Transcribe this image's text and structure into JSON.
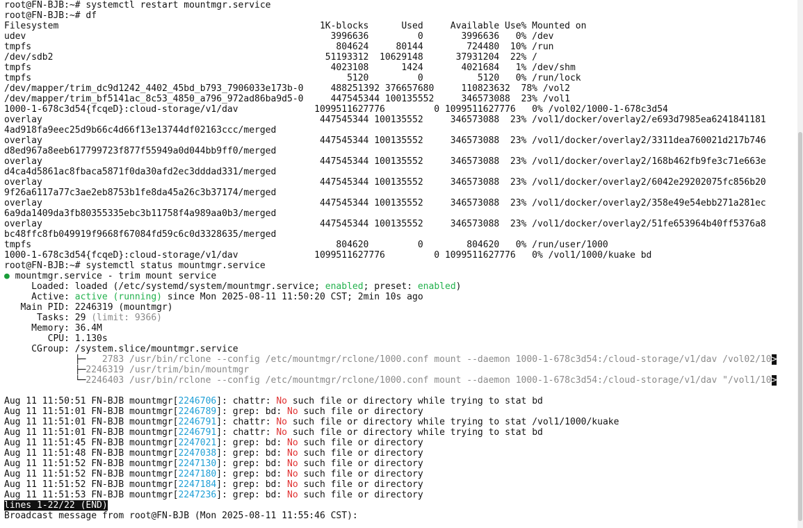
{
  "terminal": {
    "l1": "root@FN-BJB:~# systemctl restart mountmgr.service",
    "l2": "root@FN-BJB:~# df",
    "l3": "Filesystem                                                1K-blocks      Used     Available Use% Mounted on",
    "l4": "udev                                                        3996636         0       3996636   0% /dev",
    "l5": "tmpfs                                                        804624     80144        724480  10% /run",
    "l6": "/dev/sdb2                                                  51193312  10629148      37931204  22% /",
    "l7": "tmpfs                                                       4023108      1424       4021684   1% /dev/shm",
    "l8": "tmpfs                                                          5120         0          5120   0% /run/lock",
    "l9": "/dev/mapper/trim_dc9d1242_4402_45bd_b793_7906033e173b-0     488251392 376657680     110823632  78% /vol2",
    "l10": "/dev/mapper/trim_bf5141ac_8c53_4850_a796_972ad86ba9d5-0     447545344 100135552     346573088  23% /vol1",
    "l11": "1000-1-678c3d54{fcqeD}:cloud-storage/v1/dav              1099511627776         0 1099511627776   0% /vol02/1000-1-678c3d54",
    "l12": "overlay                                                   447545344 100135552     346573088  23% /vol1/docker/overlay2/e693d7985ea6241841181",
    "l13": "4ad918fa9eec25d9b66c4d66f13e13744df02163ccc/merged",
    "l14": "overlay                                                   447545344 100135552     346573088  23% /vol1/docker/overlay2/3311dea760021d217b746",
    "l15": "d8ed967a8eeb617799723f877f55949a0d044bb9ff0/merged",
    "l16": "overlay                                                   447545344 100135552     346573088  23% /vol1/docker/overlay2/168b462fb9fe3c71e663e",
    "l17": "d4ca4d5861ac8fbaca5871f0da30afd2ec3dddad331/merged",
    "l18": "overlay                                                   447545344 100135552     346573088  23% /vol1/docker/overlay2/6042e29202075fc856b20",
    "l19": "9f26a6117a77c3ae2eb8753b1fe8da45a26c3b37174/merged",
    "l20": "overlay                                                   447545344 100135552     346573088  23% /vol1/docker/overlay2/358e49e54ebb271a281ec",
    "l21": "6a9da1409da3fb80355335ebc3b11758f4a989aa0b3/merged",
    "l22": "overlay                                                   447545344 100135552     346573088  23% /vol1/docker/overlay2/51fe653964b40ff5376a8",
    "l23": "bc48ffc8fb049919f9668f67084fd59c6c0d3328635/merged",
    "l24": "tmpfs                                                        804620         0        804620   0% /run/user/1000",
    "l25": "1000-1-678c3d54{fcqeD}:cloud-storage/v1/dav              1099511627776         0 1099511627776   0% /vol1/1000/kuake bd",
    "l26": "root@FN-BJB:~# systemctl status mountmgr.service",
    "s1_dot": "●",
    "s1": " mountmgr.service - trim mount service",
    "s2a": "     Loaded: loaded (/etc/systemd/system/mountmgr.service; ",
    "s2b": "enabled",
    "s2c": "; preset: ",
    "s2d": "enabled",
    "s2e": ")",
    "s3a": "     Active: ",
    "s3b": "active (running)",
    "s3c": " since Mon 2025-08-11 11:50:20 CST; 2min 10s ago",
    "s4": "   Main PID: 2246319 (mountmgr)",
    "s5a": "      Tasks: 29 ",
    "s5b": "(limit: 9366)",
    "s6": "     Memory: 36.4M",
    "s7": "        CPU: 1.130s",
    "s8": "     CGroup: /system.slice/mountmgr.service",
    "s9a": "             ├─",
    "s9b": "   2783 /usr/bin/rclone --config /etc/mountmgr/rclone/1000.conf mount --daemon 1000-1-678c3d54:/cloud-storage/v1/dav /vol02/10",
    "s10a": "             ├─",
    "s10b": "2246319 /usr/trim/bin/mountmgr",
    "s11a": "             └─",
    "s11b": "2246403 /usr/bin/rclone --config /etc/mountmgr/rclone/1000.conf mount --daemon 1000-1-678c3d54:/cloud-storage/v1/dav \"/vol1/10",
    "trunc": ">",
    "log": [
      {
        "pre": "Aug 11 11:50:51 FN-BJB mountmgr[",
        "pid": "2246706",
        "mid": "]: chattr: ",
        "no": "No",
        "rest": " such file or directory while trying to stat bd"
      },
      {
        "pre": "Aug 11 11:51:01 FN-BJB mountmgr[",
        "pid": "2246789",
        "mid": "]: grep: bd: ",
        "no": "No",
        "rest": " such file or directory"
      },
      {
        "pre": "Aug 11 11:51:01 FN-BJB mountmgr[",
        "pid": "2246791",
        "mid": "]: chattr: ",
        "no": "No",
        "rest": " such file or directory while trying to stat /vol1/1000/kuake"
      },
      {
        "pre": "Aug 11 11:51:01 FN-BJB mountmgr[",
        "pid": "2246791",
        "mid": "]: chattr: ",
        "no": "No",
        "rest": " such file or directory while trying to stat bd"
      },
      {
        "pre": "Aug 11 11:51:45 FN-BJB mountmgr[",
        "pid": "2247021",
        "mid": "]: grep: bd: ",
        "no": "No",
        "rest": " such file or directory"
      },
      {
        "pre": "Aug 11 11:51:48 FN-BJB mountmgr[",
        "pid": "2247038",
        "mid": "]: grep: bd: ",
        "no": "No",
        "rest": " such file or directory"
      },
      {
        "pre": "Aug 11 11:51:52 FN-BJB mountmgr[",
        "pid": "2247130",
        "mid": "]: grep: bd: ",
        "no": "No",
        "rest": " such file or directory"
      },
      {
        "pre": "Aug 11 11:51:52 FN-BJB mountmgr[",
        "pid": "2247180",
        "mid": "]: grep: bd: ",
        "no": "No",
        "rest": " such file or directory"
      },
      {
        "pre": "Aug 11 11:51:52 FN-BJB mountmgr[",
        "pid": "2247184",
        "mid": "]: grep: bd: ",
        "no": "No",
        "rest": " such file or directory"
      },
      {
        "pre": "Aug 11 11:51:53 FN-BJB mountmgr[",
        "pid": "2247236",
        "mid": "]: grep: bd: ",
        "no": "No",
        "rest": " such file or directory"
      }
    ],
    "pager_status": "lines 1-22/22 (END)",
    "broadcast": "Broadcast message from root@FN-BJB (Mon 2025-08-11 11:55:46 CST):"
  },
  "colors": {
    "background": "#ffffff",
    "text": "#111111",
    "enabled_green": "#22b14c",
    "error_red": "#e03131",
    "pid_blue": "#1e9fd6",
    "dim_gray": "#8a8a8a"
  }
}
